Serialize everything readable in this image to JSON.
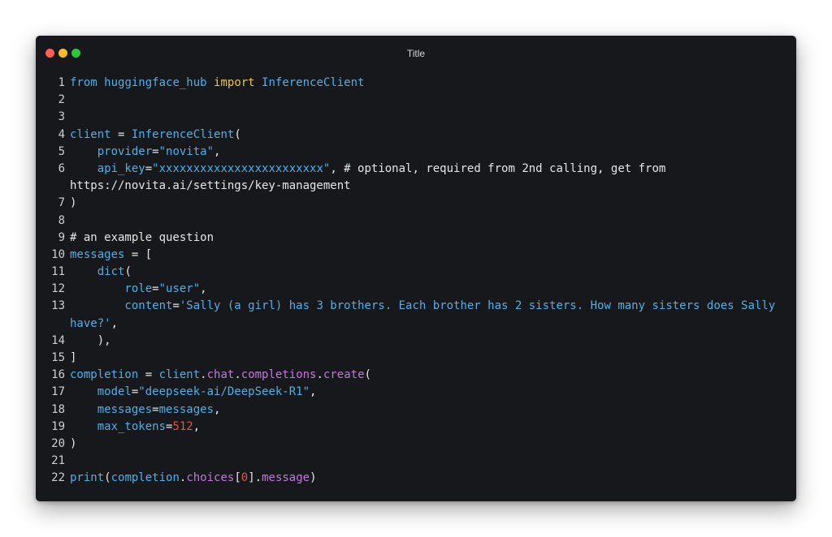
{
  "window": {
    "title": "Title",
    "controls": [
      "close",
      "minimize",
      "zoom"
    ]
  },
  "code": {
    "language": "python",
    "lines": [
      {
        "n": "1",
        "tokens": [
          {
            "t": "from ",
            "c": "blue"
          },
          {
            "t": "huggingface_hub",
            "c": "blue"
          },
          {
            "t": " ",
            "c": "white"
          },
          {
            "t": "import",
            "c": "yellow"
          },
          {
            "t": " InferenceClient",
            "c": "blue"
          }
        ]
      },
      {
        "n": "2",
        "tokens": []
      },
      {
        "n": "3",
        "tokens": []
      },
      {
        "n": "4",
        "tokens": [
          {
            "t": "client",
            "c": "blue"
          },
          {
            "t": " = ",
            "c": "white"
          },
          {
            "t": "InferenceClient",
            "c": "blue"
          },
          {
            "t": "(",
            "c": "white"
          }
        ]
      },
      {
        "n": "5",
        "tokens": [
          {
            "t": "    provider",
            "c": "blue"
          },
          {
            "t": "=",
            "c": "white"
          },
          {
            "t": "\"novita\"",
            "c": "blue"
          },
          {
            "t": ",",
            "c": "white"
          }
        ]
      },
      {
        "n": "6",
        "tokens": [
          {
            "t": "    api_key",
            "c": "blue"
          },
          {
            "t": "=",
            "c": "white"
          },
          {
            "t": "\"xxxxxxxxxxxxxxxxxxxxxxxx\"",
            "c": "blue"
          },
          {
            "t": ", # optional, required from 2nd calling, get from",
            "c": "white"
          }
        ]
      },
      {
        "n": "",
        "wrap": true,
        "tokens": [
          {
            "t": "https://novita.ai/settings/key-management",
            "c": "white"
          }
        ]
      },
      {
        "n": "7",
        "tokens": [
          {
            "t": ")",
            "c": "white"
          }
        ]
      },
      {
        "n": "8",
        "tokens": []
      },
      {
        "n": "9",
        "tokens": [
          {
            "t": "# an example question",
            "c": "white"
          }
        ]
      },
      {
        "n": "10",
        "tokens": [
          {
            "t": "messages",
            "c": "blue"
          },
          {
            "t": " = [",
            "c": "white"
          }
        ]
      },
      {
        "n": "11",
        "tokens": [
          {
            "t": "    dict",
            "c": "blue"
          },
          {
            "t": "(",
            "c": "white"
          }
        ]
      },
      {
        "n": "12",
        "tokens": [
          {
            "t": "        role",
            "c": "blue"
          },
          {
            "t": "=",
            "c": "white"
          },
          {
            "t": "\"user\"",
            "c": "blue"
          },
          {
            "t": ",",
            "c": "white"
          }
        ]
      },
      {
        "n": "13",
        "tokens": [
          {
            "t": "        content",
            "c": "blue"
          },
          {
            "t": "=",
            "c": "white"
          },
          {
            "t": "'Sally (a girl) has 3 brothers. Each brother has 2 sisters. How many sisters does Sally",
            "c": "blue"
          }
        ]
      },
      {
        "n": "",
        "wrap": true,
        "tokens": [
          {
            "t": "have?'",
            "c": "blue"
          },
          {
            "t": ",",
            "c": "white"
          }
        ]
      },
      {
        "n": "14",
        "tokens": [
          {
            "t": "    ),",
            "c": "white"
          }
        ]
      },
      {
        "n": "15",
        "tokens": [
          {
            "t": "]",
            "c": "white"
          }
        ]
      },
      {
        "n": "16",
        "tokens": [
          {
            "t": "completion",
            "c": "blue"
          },
          {
            "t": " = ",
            "c": "white"
          },
          {
            "t": "client",
            "c": "blue"
          },
          {
            "t": ".",
            "c": "white"
          },
          {
            "t": "chat",
            "c": "purple"
          },
          {
            "t": ".",
            "c": "white"
          },
          {
            "t": "completions",
            "c": "purple"
          },
          {
            "t": ".",
            "c": "white"
          },
          {
            "t": "create",
            "c": "purple"
          },
          {
            "t": "(",
            "c": "white"
          }
        ]
      },
      {
        "n": "17",
        "tokens": [
          {
            "t": "    model",
            "c": "blue"
          },
          {
            "t": "=",
            "c": "white"
          },
          {
            "t": "\"deepseek-ai/DeepSeek-R1\"",
            "c": "blue"
          },
          {
            "t": ",",
            "c": "white"
          }
        ]
      },
      {
        "n": "18",
        "tokens": [
          {
            "t": "    messages",
            "c": "blue"
          },
          {
            "t": "=",
            "c": "white"
          },
          {
            "t": "messages",
            "c": "blue"
          },
          {
            "t": ",",
            "c": "white"
          }
        ]
      },
      {
        "n": "19",
        "tokens": [
          {
            "t": "    max_tokens",
            "c": "blue"
          },
          {
            "t": "=",
            "c": "white"
          },
          {
            "t": "512",
            "c": "red"
          },
          {
            "t": ",",
            "c": "white"
          }
        ]
      },
      {
        "n": "20",
        "tokens": [
          {
            "t": ")",
            "c": "white"
          }
        ]
      },
      {
        "n": "21",
        "tokens": []
      },
      {
        "n": "22",
        "tokens": [
          {
            "t": "print",
            "c": "blue"
          },
          {
            "t": "(",
            "c": "white"
          },
          {
            "t": "completion",
            "c": "blue"
          },
          {
            "t": ".",
            "c": "white"
          },
          {
            "t": "choices",
            "c": "purple"
          },
          {
            "t": "[",
            "c": "white"
          },
          {
            "t": "0",
            "c": "red"
          },
          {
            "t": "]",
            "c": "white"
          },
          {
            "t": ".",
            "c": "white"
          },
          {
            "t": "message",
            "c": "purple"
          },
          {
            "t": ")",
            "c": "white"
          }
        ]
      }
    ]
  },
  "colors": {
    "background": "#17181c",
    "blue": "#4fb0e6",
    "yellow": "#e8c54a",
    "purple": "#c07ad6",
    "red": "#e0533f",
    "white": "#e6e6e6"
  }
}
